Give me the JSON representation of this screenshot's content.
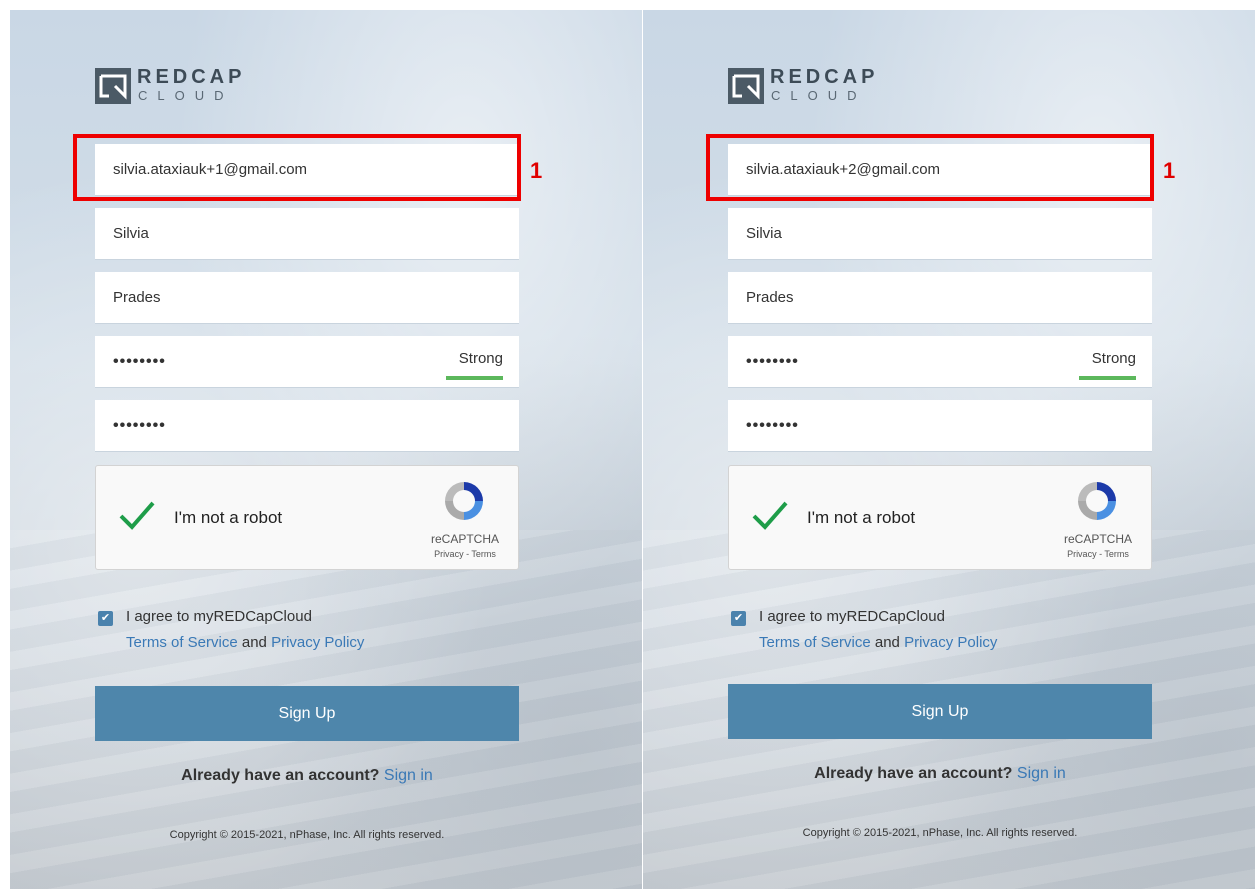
{
  "panels": [
    {
      "logo": {
        "brand": "REDCAP",
        "sub": "CLOUD"
      },
      "email": "silvia.ataxiauk+1@gmail.com",
      "first_name": "Silvia",
      "last_name": "Prades",
      "password": "••••••••",
      "password_strength": "Strong",
      "confirm_password": "••••••••",
      "captcha": {
        "label": "I'm not a robot",
        "brand": "reCAPTCHA",
        "privacy": "Privacy",
        "sep": " - ",
        "terms": "Terms"
      },
      "agree": {
        "text": "I agree to myREDCapCloud",
        "terms_link": "Terms of Service",
        "and": " and ",
        "privacy_link": "Privacy Policy"
      },
      "signup_label": "Sign Up",
      "already_text": "Already have an account?",
      "signin_link": "Sign in",
      "copyright": "Copyright © 2015-2021, nPhase, Inc. All rights reserved.",
      "callout": "1"
    },
    {
      "logo": {
        "brand": "REDCAP",
        "sub": "CLOUD"
      },
      "email": "silvia.ataxiauk+2@gmail.com",
      "first_name": "Silvia",
      "last_name": "Prades",
      "password": "••••••••",
      "password_strength": "Strong",
      "confirm_password": "••••••••",
      "captcha": {
        "label": "I'm not a robot",
        "brand": "reCAPTCHA",
        "privacy": "Privacy",
        "sep": " - ",
        "terms": "Terms"
      },
      "agree": {
        "text": "I agree to myREDCapCloud",
        "terms_link": "Terms of Service",
        "and": " and ",
        "privacy_link": "Privacy Policy"
      },
      "signup_label": "Sign Up",
      "already_text": "Already have an account?",
      "signin_link": "Sign in",
      "copyright": "Copyright © 2015-2021, nPhase, Inc. All rights reserved.",
      "callout": "1"
    }
  ],
  "colors": {
    "accent": "#4e86ab",
    "highlight": "#ee0000",
    "strength": "#5cb85c",
    "link": "#3a79b6"
  }
}
